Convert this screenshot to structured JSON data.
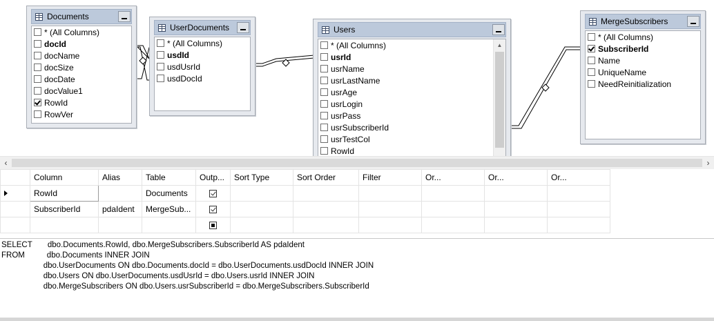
{
  "tables": [
    {
      "name": "Documents",
      "columns": [
        {
          "label": "* (All Columns)",
          "bold": false,
          "checked": false
        },
        {
          "label": "docId",
          "bold": true,
          "checked": false
        },
        {
          "label": "docName",
          "bold": false,
          "checked": false
        },
        {
          "label": "docSize",
          "bold": false,
          "checked": false
        },
        {
          "label": "docDate",
          "bold": false,
          "checked": false
        },
        {
          "label": "docValue1",
          "bold": false,
          "checked": false
        },
        {
          "label": "RowId",
          "bold": false,
          "checked": true
        },
        {
          "label": "RowVer",
          "bold": false,
          "checked": false
        }
      ]
    },
    {
      "name": "UserDocuments",
      "columns": [
        {
          "label": "* (All Columns)",
          "bold": false,
          "checked": false
        },
        {
          "label": "usdId",
          "bold": true,
          "checked": false
        },
        {
          "label": "usdUsrId",
          "bold": false,
          "checked": false
        },
        {
          "label": "usdDocId",
          "bold": false,
          "checked": false
        }
      ]
    },
    {
      "name": "Users",
      "columns": [
        {
          "label": "* (All Columns)",
          "bold": false,
          "checked": false
        },
        {
          "label": "usrId",
          "bold": true,
          "checked": false
        },
        {
          "label": "usrName",
          "bold": false,
          "checked": false
        },
        {
          "label": "usrLastName",
          "bold": false,
          "checked": false
        },
        {
          "label": "usrAge",
          "bold": false,
          "checked": false
        },
        {
          "label": "usrLogin",
          "bold": false,
          "checked": false
        },
        {
          "label": "usrPass",
          "bold": false,
          "checked": false
        },
        {
          "label": "usrSubscriberId",
          "bold": false,
          "checked": false
        },
        {
          "label": "usrTestCol",
          "bold": false,
          "checked": false
        },
        {
          "label": "RowId",
          "bold": false,
          "checked": false
        }
      ]
    },
    {
      "name": "MergeSubscribers",
      "columns": [
        {
          "label": "* (All Columns)",
          "bold": false,
          "checked": false
        },
        {
          "label": "SubscriberId",
          "bold": true,
          "checked": true
        },
        {
          "label": "Name",
          "bold": false,
          "checked": false
        },
        {
          "label": "UniqueName",
          "bold": false,
          "checked": false
        },
        {
          "label": "NeedReinitialization",
          "bold": false,
          "checked": false
        }
      ]
    }
  ],
  "grid": {
    "headers": [
      "Column",
      "Alias",
      "Table",
      "Outp...",
      "Sort Type",
      "Sort Order",
      "Filter",
      "Or...",
      "Or...",
      "Or..."
    ],
    "rows": [
      {
        "column": "RowId",
        "alias": "",
        "table": "Documents",
        "output": "checked",
        "current": true
      },
      {
        "column": "SubscriberId",
        "alias": "pdaIdent",
        "table": "MergeSub...",
        "output": "checked",
        "current": false
      },
      {
        "column": "",
        "alias": "",
        "table": "",
        "output": "filled",
        "current": false
      }
    ]
  },
  "sql": [
    "SELECT       dbo.Documents.RowId, dbo.MergeSubscribers.SubscriberId AS pdaIdent",
    "FROM          dbo.Documents INNER JOIN",
    "                   dbo.UserDocuments ON dbo.Documents.docId = dbo.UserDocuments.usdDocId INNER JOIN",
    "                   dbo.Users ON dbo.UserDocuments.usdUsrId = dbo.Users.usrId INNER JOIN",
    "                   dbo.MergeSubscribers ON dbo.Users.usrSubscriberId = dbo.MergeSubscribers.SubscriberId"
  ],
  "colors": {
    "titlebar": "#bcc9db",
    "window": "#e6e9ee",
    "connector": "#000000"
  }
}
